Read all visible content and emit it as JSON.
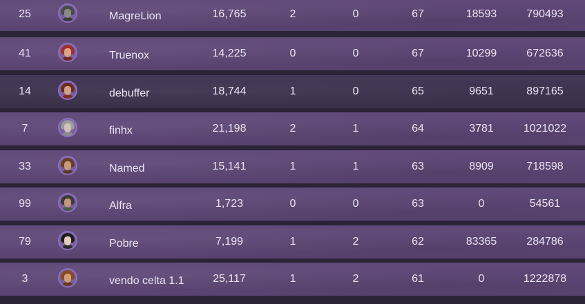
{
  "leaderboard": {
    "rows": [
      {
        "rank": "25",
        "name": "MagreLion",
        "score": "16,765",
        "col_a": "2",
        "col_b": "0",
        "level": "67",
        "col_c": "18593",
        "col_d": "790493",
        "avatar": {
          "hair": "#4b4b4b",
          "skin": "#8a8a8a",
          "body": "#3a3a3a"
        }
      },
      {
        "rank": "41",
        "name": "Truenox",
        "score": "14,225",
        "col_a": "0",
        "col_b": "0",
        "level": "67",
        "col_c": "10299",
        "col_d": "672636",
        "avatar": {
          "hair": "#a3302a",
          "skin": "#d8a58a",
          "body": "#6b2a2a"
        }
      },
      {
        "rank": "14",
        "name": "debuffer",
        "score": "18,744",
        "col_a": "1",
        "col_b": "0",
        "level": "65",
        "col_c": "9651",
        "col_d": "897165",
        "highlight": true,
        "avatar": {
          "hair": "#6e2b20",
          "skin": "#d2a08a",
          "body": "#7a2f2a"
        }
      },
      {
        "rank": "7",
        "name": "finhx",
        "score": "21,198",
        "col_a": "2",
        "col_b": "1",
        "level": "64",
        "col_c": "3781",
        "col_d": "1021022",
        "avatar": {
          "hair": "#9a9a9a",
          "skin": "#cfc3b8",
          "body": "#8b8b8b"
        }
      },
      {
        "rank": "33",
        "name": "Named",
        "score": "15,141",
        "col_a": "1",
        "col_b": "1",
        "level": "63",
        "col_c": "8909",
        "col_d": "718598",
        "avatar": {
          "hair": "#6b3f22",
          "skin": "#c99a7a",
          "body": "#5a3a28"
        }
      },
      {
        "rank": "99",
        "name": "Alfra",
        "score": "1,723",
        "col_a": "0",
        "col_b": "0",
        "level": "63",
        "col_c": "0",
        "col_d": "54561",
        "avatar": {
          "hair": "#3b3b3b",
          "skin": "#c2987a",
          "body": "#4a5a4a"
        }
      },
      {
        "rank": "79",
        "name": "Pobre",
        "score": "7,199",
        "col_a": "1",
        "col_b": "2",
        "level": "62",
        "col_c": "83365",
        "col_d": "284786",
        "avatar": {
          "hair": "#1e1e1e",
          "skin": "#e4cfc0",
          "body": "#2a2a2a"
        }
      },
      {
        "rank": "3",
        "name": "vendo celta 1.1",
        "score": "25,117",
        "col_a": "1",
        "col_b": "2",
        "level": "61",
        "col_c": "0",
        "col_d": "1222878",
        "avatar": {
          "hair": "#8a4a22",
          "skin": "#cf9f7a",
          "body": "#6a3a20"
        }
      }
    ]
  }
}
